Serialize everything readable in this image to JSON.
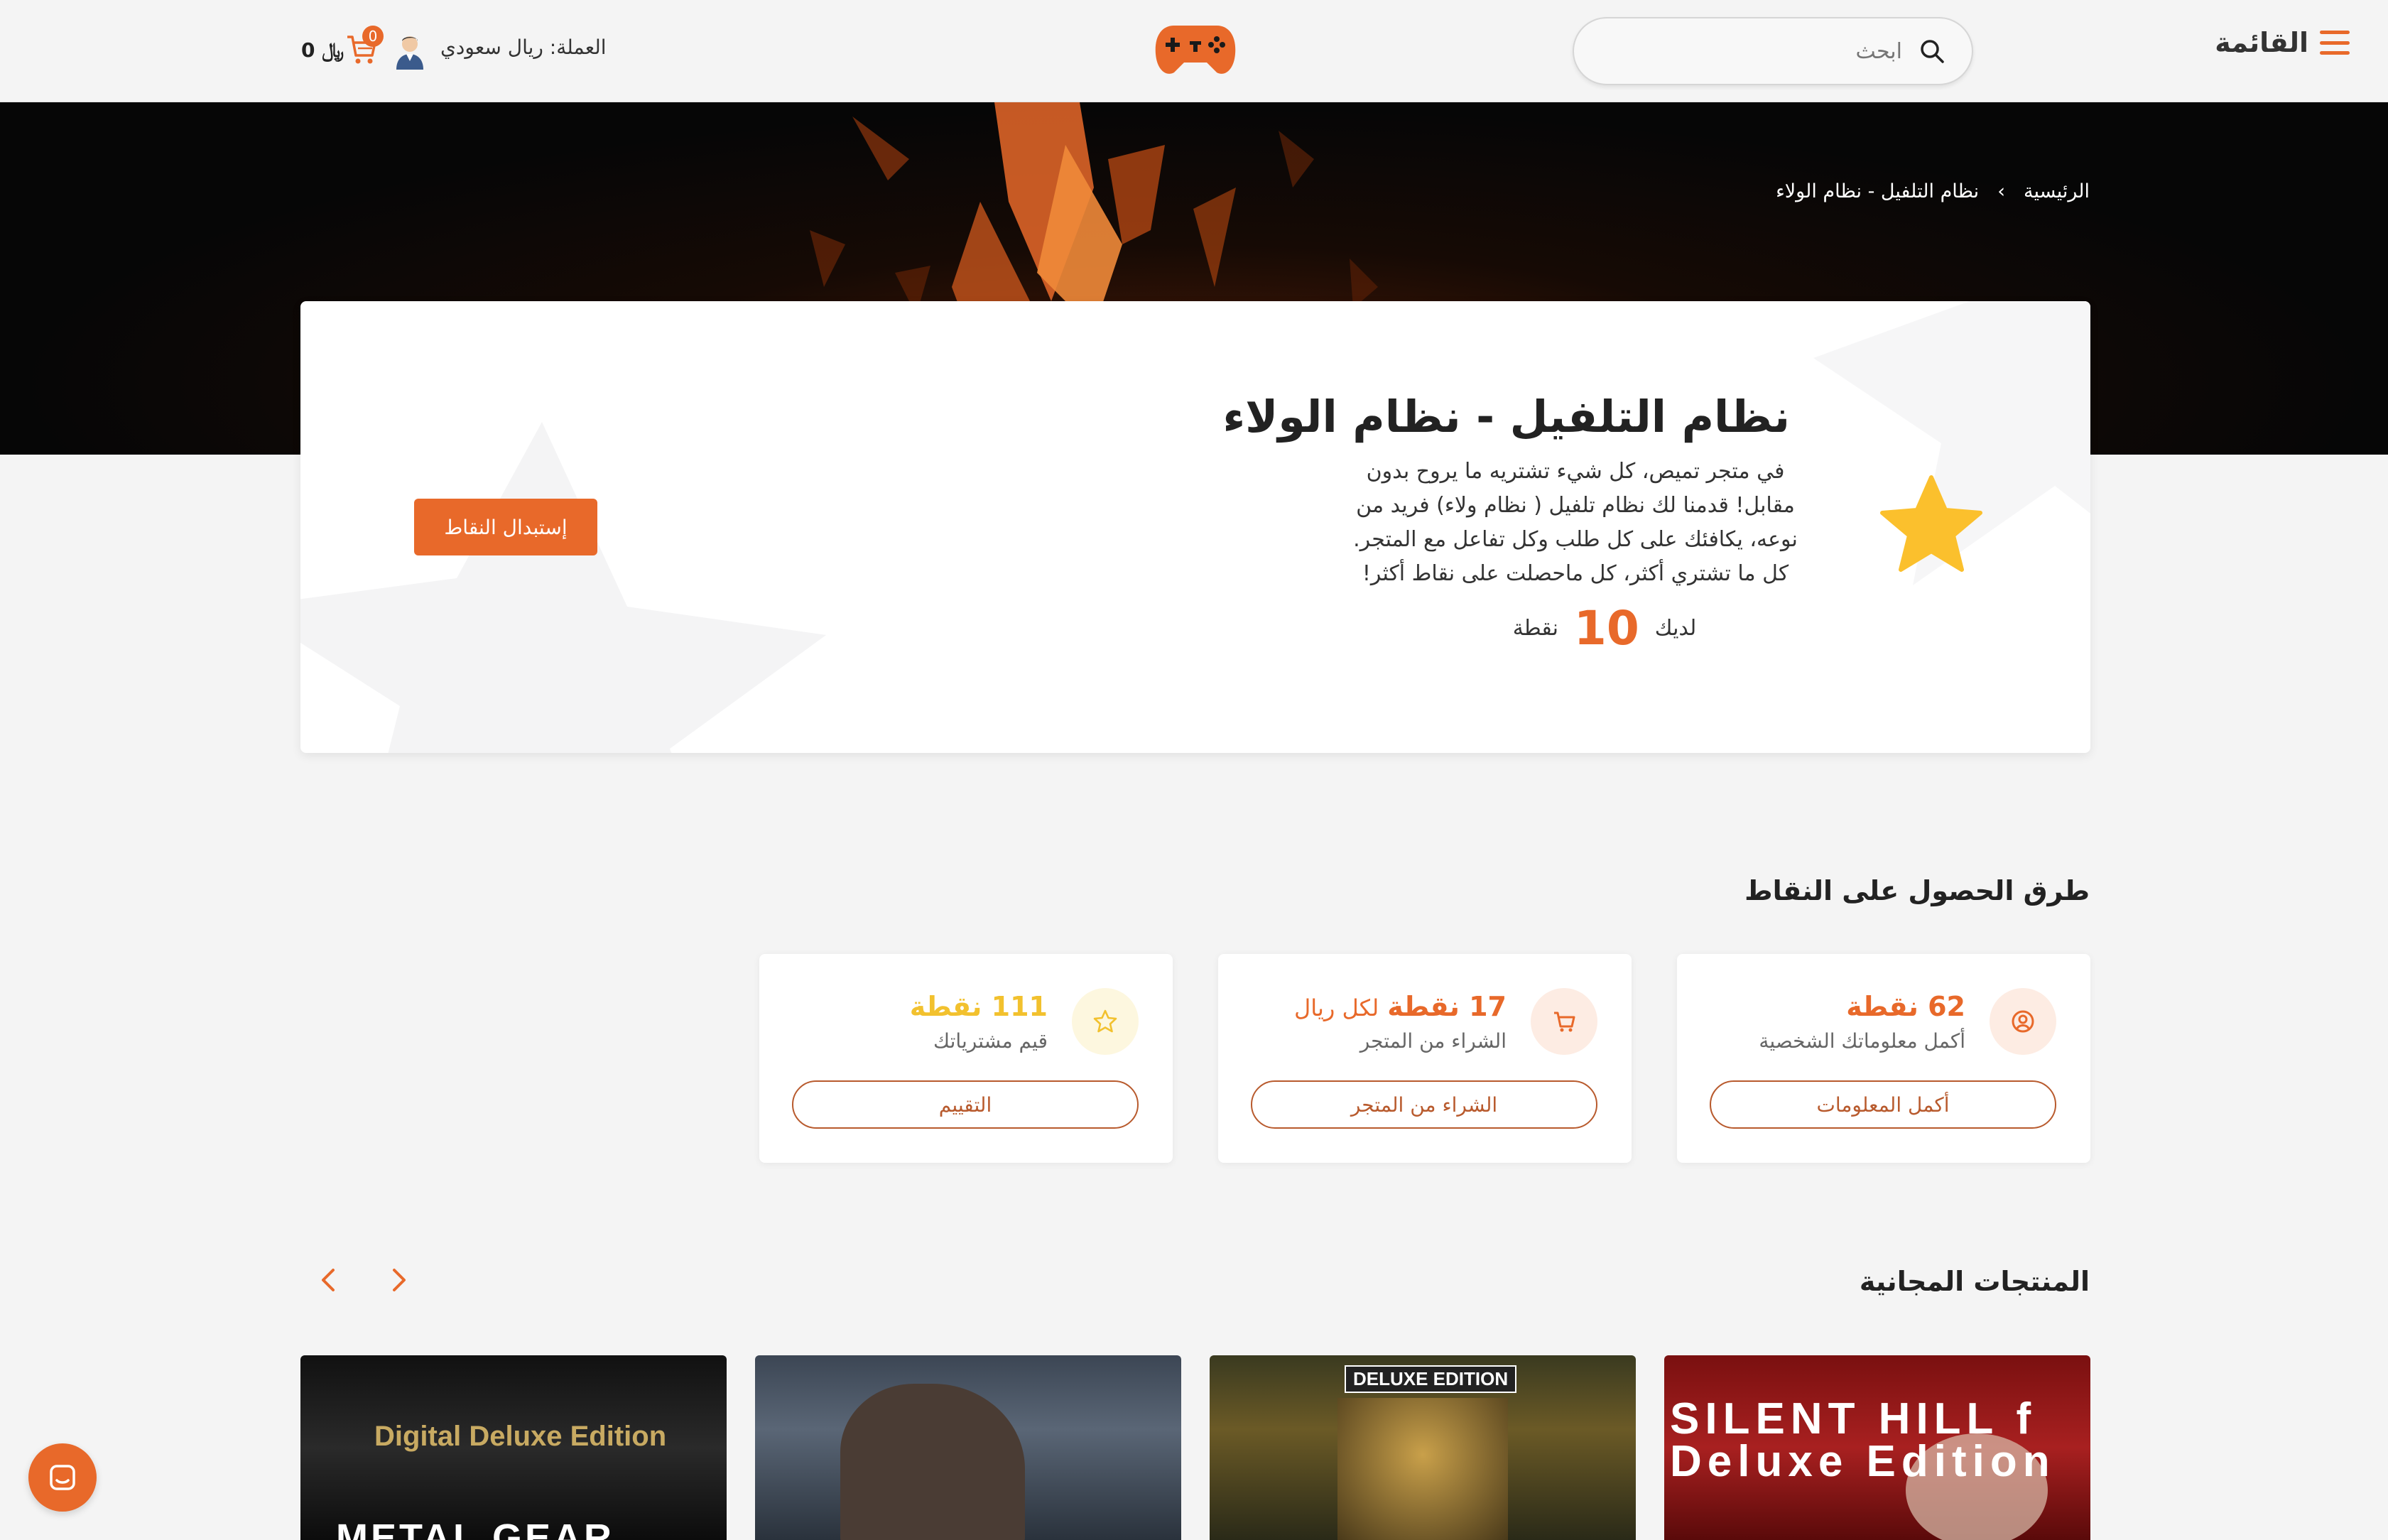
{
  "header": {
    "menu_label": "القائمة",
    "search_placeholder": "ابحث",
    "currency_label": "العملة: ريال سعودي",
    "cart_count": "0",
    "cart_total": "0 ﷼"
  },
  "breadcrumb": {
    "home": "الرئيسية",
    "separator": "›",
    "current": "نظام التلفيل - نظام الولاء"
  },
  "loyalty": {
    "title": "نظام التلفيل - نظام الولاء",
    "description": "في متجر تميص، كل شيء تشتريه ما يروح بدون مقابل! قدمنا لك نظام تلفيل ( نظام ولاء) فريد من نوعه، يكافئك على كل طلب وكل تفاعل مع المتجر. كل ما تشتري أكثر، كل ماحصلت على نقاط أكثر!",
    "points_prefix": "لديك",
    "points_value": "10",
    "points_unit": "نقطة",
    "redeem_button": "إستبدال النقاط"
  },
  "earn_section": {
    "title": "طرق الحصول على النقاط",
    "cards": [
      {
        "points": "62 نقطة",
        "subtitle": "أكمل معلوماتك الشخصية",
        "button": "أكمل المعلومات",
        "icon": "user-circle-icon",
        "color": "#e8692a"
      },
      {
        "points": "17 نقطة",
        "points_suffix": "لكل ريال",
        "subtitle": "الشراء من المتجر",
        "button": "الشراء من المتجر",
        "icon": "cart-icon",
        "color": "#e8692a"
      },
      {
        "points": "111 نقطة",
        "subtitle": "قيم مشترياتك",
        "button": "التقييم",
        "icon": "star-icon",
        "color": "#f2c12e"
      }
    ]
  },
  "free_products": {
    "title": "المنتجات المجانية",
    "items": [
      {
        "label": "SILENT HILL f Deluxe Edition"
      },
      {
        "label": "DELUXE EDITION"
      },
      {
        "label": ""
      },
      {
        "label": "Digital Deluxe Edition",
        "sublabel": "METAL GEAR SOLID"
      }
    ]
  },
  "colors": {
    "accent": "#e8692a",
    "gold": "#f2c12e",
    "outline": "#b85a2d"
  }
}
